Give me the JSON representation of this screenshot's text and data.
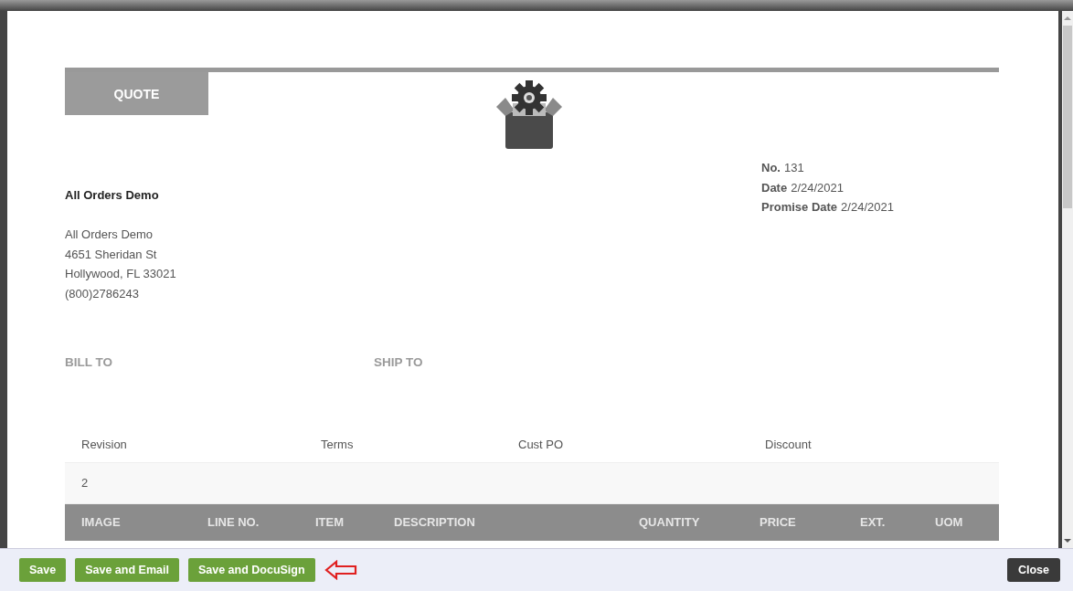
{
  "document": {
    "badge": "QUOTE",
    "company": {
      "name": "All Orders Demo",
      "address_lines": [
        "All Orders Demo",
        "4651 Sheridan St",
        "Hollywood, FL 33021",
        "(800)2786243"
      ]
    },
    "meta": [
      {
        "label": "No.",
        "value": "131"
      },
      {
        "label": "Date",
        "value": "2/24/2021"
      },
      {
        "label": "Promise Date",
        "value": "2/24/2021"
      }
    ],
    "parties": [
      "BILL TO",
      "SHIP TO"
    ],
    "info_table": {
      "columns": [
        "Revision",
        "Terms",
        "Cust PO",
        "Discount"
      ],
      "values": [
        "2"
      ]
    },
    "items_table": {
      "columns": [
        "IMAGE",
        "LINE NO.",
        "ITEM",
        "DESCRIPTION",
        "QUANTITY",
        "PRICE",
        "EXT.",
        "UOM"
      ]
    }
  },
  "footer": {
    "buttons": [
      {
        "label": "Save",
        "kind": "primary"
      },
      {
        "label": "Save and Email",
        "kind": "primary"
      },
      {
        "label": "Save and DocuSign",
        "kind": "primary"
      }
    ],
    "close": "Close"
  }
}
